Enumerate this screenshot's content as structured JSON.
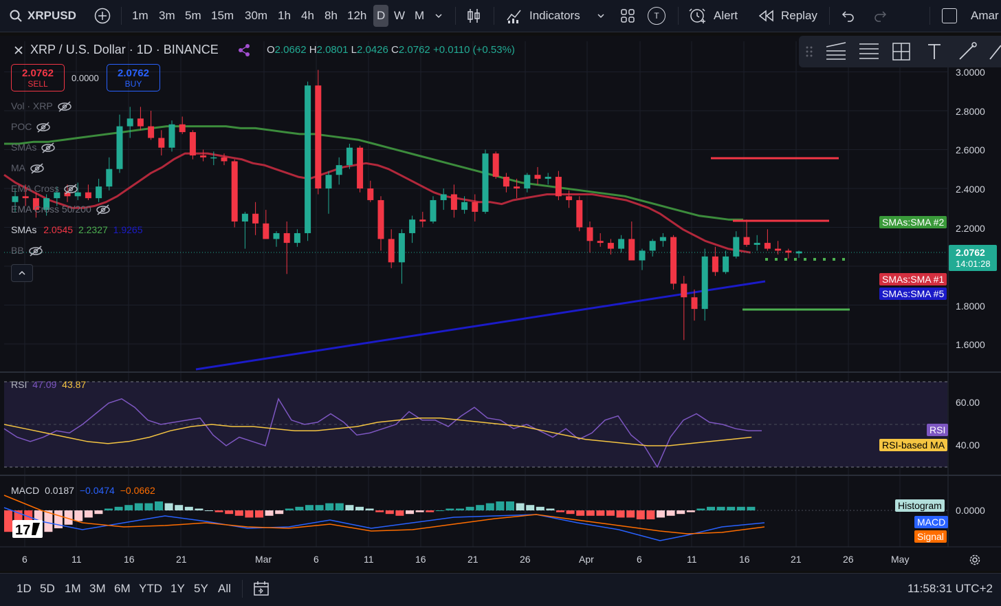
{
  "header": {
    "symbol": "XRPUSD",
    "intervals": [
      "1m",
      "3m",
      "5m",
      "15m",
      "30m",
      "1h",
      "4h",
      "8h",
      "12h",
      "D",
      "W",
      "M"
    ],
    "selected_interval": "D",
    "indicators_label": "Indicators",
    "alert_label": "Alert",
    "replay_label": "Replay",
    "account_label": "Amar",
    "template_badge": "T"
  },
  "legend": {
    "title": "XRP / U.S. Dollar · 1D · BINANCE",
    "o_label": "O",
    "o": "2.0662",
    "h_label": "H",
    "h": "2.0801",
    "l_label": "L",
    "l": "2.0426",
    "c_label": "C",
    "c": "2.0762",
    "change": "+0.0110 (+0.53%)"
  },
  "trade": {
    "sell_price": "2.0762",
    "sell_label": "SELL",
    "spread": "0.0000",
    "buy_price": "2.0762",
    "buy_label": "BUY"
  },
  "indicators": [
    {
      "name": "Vol · XRP",
      "hidden": true
    },
    {
      "name": "POC",
      "hidden": true
    },
    {
      "name": "SMAs",
      "hidden": true
    },
    {
      "name": "MA",
      "hidden": true
    },
    {
      "name": "EMA Cross",
      "hidden": true
    },
    {
      "name": "EMA Cross 50/200",
      "hidden": true
    },
    {
      "name": "SMAs",
      "hidden": false,
      "values": [
        "2.0545",
        "2.2327",
        "1.9265"
      ]
    },
    {
      "name": "BB",
      "hidden": true
    }
  ],
  "price_axis": [
    "3.0000",
    "2.8000",
    "2.6000",
    "2.4000",
    "2.2000",
    "1.8000",
    "1.6000"
  ],
  "last_price": {
    "value": "2.0762",
    "countdown": "14:01:28"
  },
  "sma_tags": {
    "sma2": "SMAs:SMA #2",
    "sma1": "SMAs:SMA #1",
    "sma5": "SMAs:SMA #5"
  },
  "rsi": {
    "label": "RSI",
    "value": "47.09",
    "ma_value": "43.87",
    "axis": [
      "60.00",
      "40.00"
    ],
    "tag_rsi": "RSI",
    "tag_ma": "RSI-based MA"
  },
  "macd": {
    "label": "MACD",
    "v1": "0.0187",
    "v2": "−0.0474",
    "v3": "−0.0662",
    "axis": "0.0000",
    "tag_hist": "Histogram",
    "tag_macd": "MACD",
    "tag_signal": "Signal"
  },
  "time_axis": [
    "6",
    "11",
    "16",
    "21",
    "Mar",
    "6",
    "11",
    "16",
    "21",
    "26",
    "Apr",
    "6",
    "11",
    "16",
    "21",
    "26",
    "May"
  ],
  "ranges": [
    "1D",
    "5D",
    "1M",
    "3M",
    "6M",
    "YTD",
    "1Y",
    "5Y",
    "All"
  ],
  "clock": "11:58:31 UTC+2",
  "colors": {
    "up": "#22ab94",
    "down": "#f23645",
    "sma1": "#b2283b",
    "sma2": "#3c8c3c",
    "sma5": "#1b1bc8",
    "rsi": "#7e57c2",
    "rsi_ma": "#f5c542"
  },
  "chart_data": {
    "type": "candlestick",
    "ylim": [
      1.5,
      3.05
    ],
    "candles": [
      {
        "o": 2.33,
        "h": 2.4,
        "l": 2.28,
        "c": 2.36
      },
      {
        "o": 2.36,
        "h": 2.42,
        "l": 2.31,
        "c": 2.35
      },
      {
        "o": 2.35,
        "h": 2.38,
        "l": 2.25,
        "c": 2.29
      },
      {
        "o": 2.29,
        "h": 2.37,
        "l": 2.26,
        "c": 2.35
      },
      {
        "o": 2.35,
        "h": 2.41,
        "l": 2.31,
        "c": 2.38
      },
      {
        "o": 2.38,
        "h": 2.42,
        "l": 2.33,
        "c": 2.36
      },
      {
        "o": 2.36,
        "h": 2.43,
        "l": 2.34,
        "c": 2.38
      },
      {
        "o": 2.38,
        "h": 2.42,
        "l": 2.34,
        "c": 2.35
      },
      {
        "o": 2.35,
        "h": 2.45,
        "l": 2.33,
        "c": 2.41
      },
      {
        "o": 2.41,
        "h": 2.56,
        "l": 2.39,
        "c": 2.5
      },
      {
        "o": 2.5,
        "h": 2.78,
        "l": 2.48,
        "c": 2.72
      },
      {
        "o": 2.72,
        "h": 2.82,
        "l": 2.66,
        "c": 2.76
      },
      {
        "o": 2.76,
        "h": 2.82,
        "l": 2.7,
        "c": 2.72
      },
      {
        "o": 2.72,
        "h": 2.8,
        "l": 2.65,
        "c": 2.66
      },
      {
        "o": 2.66,
        "h": 2.7,
        "l": 2.57,
        "c": 2.61
      },
      {
        "o": 2.61,
        "h": 2.75,
        "l": 2.59,
        "c": 2.73
      },
      {
        "o": 2.73,
        "h": 2.77,
        "l": 2.68,
        "c": 2.69
      },
      {
        "o": 2.69,
        "h": 2.7,
        "l": 2.55,
        "c": 2.57
      },
      {
        "o": 2.57,
        "h": 2.6,
        "l": 2.54,
        "c": 2.56
      },
      {
        "o": 2.56,
        "h": 2.59,
        "l": 2.52,
        "c": 2.56
      },
      {
        "o": 2.56,
        "h": 2.58,
        "l": 2.52,
        "c": 2.54
      },
      {
        "o": 2.54,
        "h": 2.55,
        "l": 2.2,
        "c": 2.23
      },
      {
        "o": 2.23,
        "h": 2.28,
        "l": 2.09,
        "c": 2.27
      },
      {
        "o": 2.27,
        "h": 2.33,
        "l": 2.16,
        "c": 2.22
      },
      {
        "o": 2.22,
        "h": 2.29,
        "l": 2.14,
        "c": 2.14
      },
      {
        "o": 2.14,
        "h": 2.18,
        "l": 2.1,
        "c": 2.17
      },
      {
        "o": 2.17,
        "h": 2.23,
        "l": 1.96,
        "c": 2.12
      },
      {
        "o": 2.12,
        "h": 2.19,
        "l": 2.1,
        "c": 2.17
      },
      {
        "o": 2.17,
        "h": 2.95,
        "l": 2.13,
        "c": 2.93
      },
      {
        "o": 2.93,
        "h": 3.01,
        "l": 2.37,
        "c": 2.4
      },
      {
        "o": 2.4,
        "h": 2.49,
        "l": 2.27,
        "c": 2.47
      },
      {
        "o": 2.47,
        "h": 2.56,
        "l": 2.42,
        "c": 2.52
      },
      {
        "o": 2.52,
        "h": 2.63,
        "l": 2.5,
        "c": 2.61
      },
      {
        "o": 2.61,
        "h": 2.62,
        "l": 2.38,
        "c": 2.4
      },
      {
        "o": 2.4,
        "h": 2.44,
        "l": 2.33,
        "c": 2.34
      },
      {
        "o": 2.34,
        "h": 2.36,
        "l": 2.08,
        "c": 2.14
      },
      {
        "o": 2.14,
        "h": 2.19,
        "l": 1.99,
        "c": 2.02
      },
      {
        "o": 2.02,
        "h": 2.19,
        "l": 1.91,
        "c": 2.17
      },
      {
        "o": 2.17,
        "h": 2.26,
        "l": 2.12,
        "c": 2.24
      },
      {
        "o": 2.24,
        "h": 2.28,
        "l": 2.2,
        "c": 2.23
      },
      {
        "o": 2.23,
        "h": 2.36,
        "l": 2.22,
        "c": 2.34
      },
      {
        "o": 2.34,
        "h": 2.4,
        "l": 2.29,
        "c": 2.37
      },
      {
        "o": 2.37,
        "h": 2.42,
        "l": 2.25,
        "c": 2.29
      },
      {
        "o": 2.29,
        "h": 2.36,
        "l": 2.27,
        "c": 2.33
      },
      {
        "o": 2.33,
        "h": 2.37,
        "l": 2.23,
        "c": 2.28
      },
      {
        "o": 2.28,
        "h": 2.6,
        "l": 2.27,
        "c": 2.58
      },
      {
        "o": 2.58,
        "h": 2.59,
        "l": 2.45,
        "c": 2.46
      },
      {
        "o": 2.46,
        "h": 2.48,
        "l": 2.38,
        "c": 2.41
      },
      {
        "o": 2.41,
        "h": 2.45,
        "l": 2.35,
        "c": 2.4
      },
      {
        "o": 2.4,
        "h": 2.48,
        "l": 2.38,
        "c": 2.47
      },
      {
        "o": 2.47,
        "h": 2.51,
        "l": 2.42,
        "c": 2.45
      },
      {
        "o": 2.45,
        "h": 2.48,
        "l": 2.42,
        "c": 2.46
      },
      {
        "o": 2.46,
        "h": 2.49,
        "l": 2.34,
        "c": 2.36
      },
      {
        "o": 2.36,
        "h": 2.39,
        "l": 2.3,
        "c": 2.34
      },
      {
        "o": 2.34,
        "h": 2.36,
        "l": 2.18,
        "c": 2.2
      },
      {
        "o": 2.2,
        "h": 2.23,
        "l": 2.07,
        "c": 2.13
      },
      {
        "o": 2.13,
        "h": 2.17,
        "l": 2.1,
        "c": 2.12
      },
      {
        "o": 2.12,
        "h": 2.14,
        "l": 2.06,
        "c": 2.09
      },
      {
        "o": 2.09,
        "h": 2.16,
        "l": 2.07,
        "c": 2.14
      },
      {
        "o": 2.14,
        "h": 2.23,
        "l": 2.06,
        "c": 2.03
      },
      {
        "o": 2.03,
        "h": 2.09,
        "l": 1.98,
        "c": 2.08
      },
      {
        "o": 2.08,
        "h": 2.14,
        "l": 2.05,
        "c": 2.13
      },
      {
        "o": 2.13,
        "h": 2.17,
        "l": 2.1,
        "c": 2.15
      },
      {
        "o": 2.15,
        "h": 2.16,
        "l": 1.88,
        "c": 1.91
      },
      {
        "o": 1.91,
        "h": 1.95,
        "l": 1.62,
        "c": 1.84
      },
      {
        "o": 1.84,
        "h": 1.88,
        "l": 1.72,
        "c": 1.78
      },
      {
        "o": 1.78,
        "h": 2.09,
        "l": 1.72,
        "c": 2.05
      },
      {
        "o": 2.05,
        "h": 2.1,
        "l": 1.95,
        "c": 1.97
      },
      {
        "o": 1.97,
        "h": 2.08,
        "l": 1.96,
        "c": 2.05
      },
      {
        "o": 2.05,
        "h": 2.18,
        "l": 2.04,
        "c": 2.15
      },
      {
        "o": 2.15,
        "h": 2.24,
        "l": 2.1,
        "c": 2.11
      },
      {
        "o": 2.11,
        "h": 2.16,
        "l": 2.08,
        "c": 2.12
      },
      {
        "o": 2.12,
        "h": 2.19,
        "l": 2.08,
        "c": 2.09
      },
      {
        "o": 2.09,
        "h": 2.13,
        "l": 2.06,
        "c": 2.08
      },
      {
        "o": 2.08,
        "h": 2.09,
        "l": 2.04,
        "c": 2.07
      },
      {
        "o": 2.066,
        "h": 2.08,
        "l": 2.043,
        "c": 2.076
      }
    ],
    "sma1": [
      2.47,
      2.43,
      2.4,
      2.37,
      2.34,
      2.32,
      2.3,
      2.3,
      2.31,
      2.33,
      2.36,
      2.4,
      2.44,
      2.48,
      2.51,
      2.55,
      2.58,
      2.58,
      2.58,
      2.57,
      2.56,
      2.55,
      2.53,
      2.52,
      2.5,
      2.48,
      2.46,
      2.45,
      2.47,
      2.49,
      2.51,
      2.52,
      2.53,
      2.52,
      2.5,
      2.47,
      2.44,
      2.41,
      2.38,
      2.36,
      2.35,
      2.34,
      2.33,
      2.33,
      2.32,
      2.34,
      2.35,
      2.36,
      2.37,
      2.37,
      2.37,
      2.37,
      2.37,
      2.36,
      2.35,
      2.34,
      2.32,
      2.3,
      2.27,
      2.23,
      2.19,
      2.16,
      2.13,
      2.11,
      2.09,
      2.08,
      2.07
    ],
    "sma2": [
      2.63,
      2.63,
      2.64,
      2.64,
      2.65,
      2.66,
      2.67,
      2.68,
      2.69,
      2.7,
      2.71,
      2.72,
      2.72,
      2.72,
      2.72,
      2.72,
      2.71,
      2.71,
      2.7,
      2.69,
      2.68,
      2.68,
      2.67,
      2.66,
      2.65,
      2.63,
      2.61,
      2.59,
      2.57,
      2.55,
      2.53,
      2.51,
      2.49,
      2.47,
      2.45,
      2.43,
      2.42,
      2.41,
      2.4,
      2.39,
      2.38,
      2.37,
      2.36,
      2.34,
      2.32,
      2.3,
      2.28,
      2.26,
      2.25,
      2.24,
      2.24
    ],
    "sma5": [
      1.49,
      1.92
    ],
    "rsi": [
      48,
      44,
      42,
      44,
      47,
      46,
      50,
      55,
      60,
      62,
      58,
      52,
      50,
      51,
      52,
      53,
      45,
      40,
      44,
      42,
      40,
      62,
      52,
      50,
      51,
      55,
      51,
      45,
      46,
      48,
      50,
      56,
      52,
      52,
      49,
      54,
      58,
      53,
      52,
      48,
      50,
      47,
      44,
      48,
      43,
      46,
      52,
      54,
      45,
      40,
      30,
      44,
      52,
      55,
      51,
      50,
      48,
      47,
      47
    ],
    "rsi_ma": [
      50,
      48,
      46,
      44,
      42,
      41,
      42,
      44,
      47,
      49,
      50,
      49,
      49,
      48,
      47,
      47,
      48,
      49,
      51,
      52,
      53,
      53,
      52,
      51,
      50,
      49,
      47,
      45,
      43,
      42,
      41,
      40,
      40,
      41,
      42,
      43,
      44
    ],
    "macd_hist": [
      -0.12,
      -0.14,
      -0.15,
      -0.14,
      -0.12,
      -0.1,
      -0.08,
      -0.06,
      -0.04,
      -0.02,
      0.01,
      0.02,
      0.03,
      0.04,
      0.04,
      0.05,
      0.04,
      0.03,
      0.02,
      0.01,
      0.0,
      -0.01,
      -0.02,
      -0.03,
      -0.04,
      -0.04,
      -0.03,
      -0.02,
      0.01,
      0.02,
      0.03,
      0.03,
      0.04,
      0.04,
      0.03,
      0.02,
      0.01,
      -0.01,
      -0.02,
      -0.03,
      -0.02,
      -0.01,
      -0.01,
      0.0,
      0.01,
      0.01,
      0.02,
      0.03,
      0.04,
      0.05,
      0.05,
      0.04,
      0.03,
      0.02,
      0.01,
      -0.01,
      -0.02,
      -0.03,
      -0.03,
      -0.03,
      -0.03,
      -0.04,
      -0.04,
      -0.05,
      -0.05,
      -0.04,
      -0.03,
      -0.02,
      -0.01,
      0.01,
      0.02,
      0.02,
      0.02,
      0.02,
      0.02
    ],
    "price_lines": [
      {
        "price": 2.56,
        "color": "red"
      },
      {
        "price": 2.24,
        "color": "red"
      },
      {
        "price": 2.07,
        "color": "green-dotted"
      },
      {
        "price": 1.78,
        "color": "green"
      }
    ]
  }
}
